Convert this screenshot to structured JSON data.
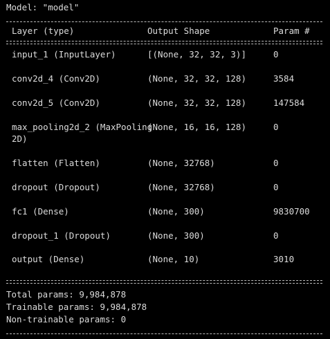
{
  "model_line": "Model: \"model\"",
  "headers": {
    "layer": "Layer (type)",
    "shape": "Output Shape",
    "param": "Param #"
  },
  "rows": [
    {
      "layer": "input_1 (InputLayer)",
      "layer2": "",
      "shape": "[(None, 32, 32, 3)]",
      "param": "0"
    },
    {
      "layer": "conv2d_4 (Conv2D)",
      "layer2": "",
      "shape": "(None, 32, 32, 128)",
      "param": "3584"
    },
    {
      "layer": "conv2d_5 (Conv2D)",
      "layer2": "",
      "shape": "(None, 32, 32, 128)",
      "param": "147584"
    },
    {
      "layer": "max_pooling2d_2 (MaxPooling",
      "layer2": "2D)",
      "shape": "(None, 16, 16, 128)",
      "param": "0"
    },
    {
      "layer": "flatten (Flatten)",
      "layer2": "",
      "shape": "(None, 32768)",
      "param": "0"
    },
    {
      "layer": "dropout (Dropout)",
      "layer2": "",
      "shape": "(None, 32768)",
      "param": "0"
    },
    {
      "layer": "fc1 (Dense)",
      "layer2": "",
      "shape": "(None, 300)",
      "param": "9830700"
    },
    {
      "layer": "dropout_1 (Dropout)",
      "layer2": "",
      "shape": "(None, 300)",
      "param": "0"
    },
    {
      "layer": "output (Dense)",
      "layer2": "",
      "shape": "(None, 10)",
      "param": "3010"
    }
  ],
  "totals": {
    "total": "Total params: 9,984,878",
    "trainable": "Trainable params: 9,984,878",
    "non_trainable": "Non-trainable params: 0"
  }
}
